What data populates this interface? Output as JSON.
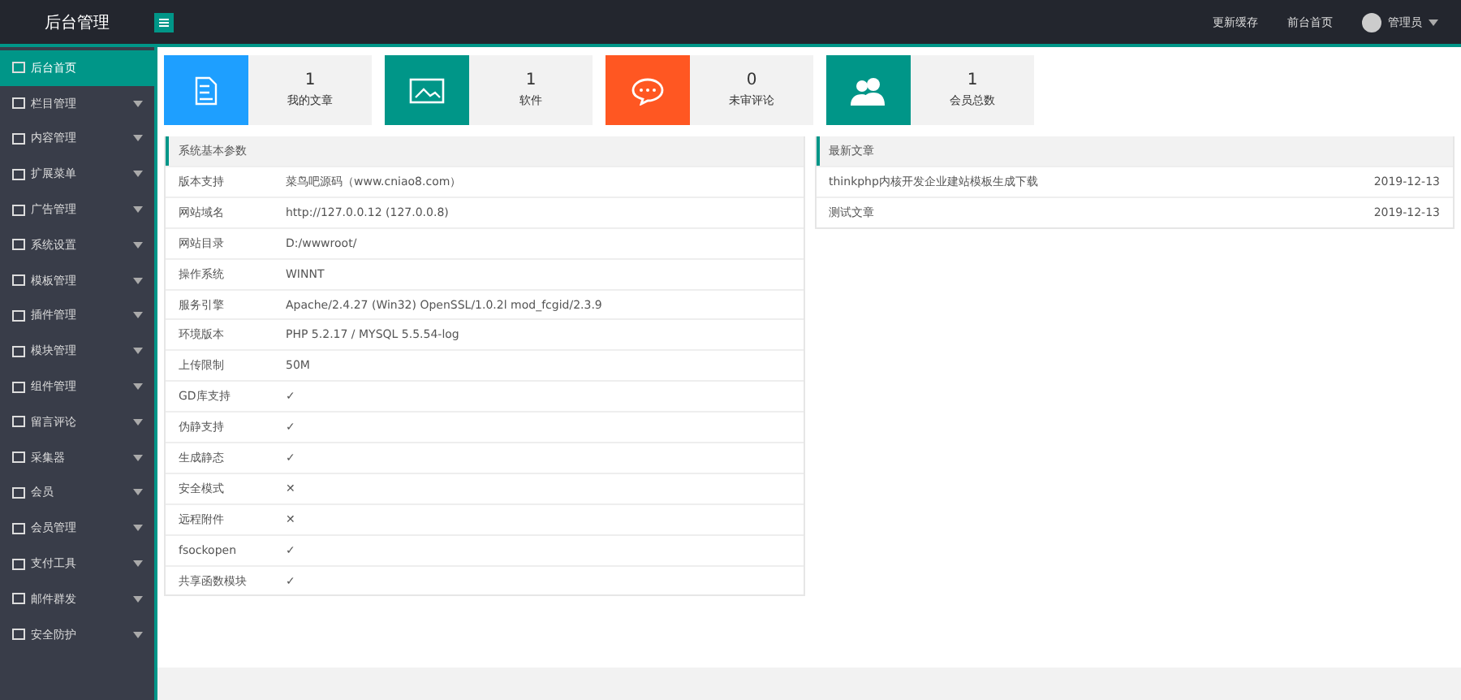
{
  "header": {
    "title": "后台管理",
    "links": [
      "更新缓存",
      "前台首页"
    ],
    "user": "管理员"
  },
  "sidebar": {
    "items": [
      {
        "label": "后台首页",
        "selected": true,
        "expandable": false
      },
      {
        "label": "栏目管理",
        "selected": false,
        "expandable": true
      },
      {
        "label": "内容管理",
        "selected": false,
        "expandable": true
      },
      {
        "label": "扩展菜单",
        "selected": false,
        "expandable": true
      },
      {
        "label": "广告管理",
        "selected": false,
        "expandable": true
      },
      {
        "label": "系统设置",
        "selected": false,
        "expandable": true
      },
      {
        "label": "模板管理",
        "selected": false,
        "expandable": true
      },
      {
        "label": "插件管理",
        "selected": false,
        "expandable": true
      },
      {
        "label": "模块管理",
        "selected": false,
        "expandable": true
      },
      {
        "label": "组件管理",
        "selected": false,
        "expandable": true
      },
      {
        "label": "留言评论",
        "selected": false,
        "expandable": true
      },
      {
        "label": "采集器",
        "selected": false,
        "expandable": true
      },
      {
        "label": "会员",
        "selected": false,
        "expandable": true
      },
      {
        "label": "会员管理",
        "selected": false,
        "expandable": true
      },
      {
        "label": "支付工具",
        "selected": false,
        "expandable": true
      },
      {
        "label": "邮件群发",
        "selected": false,
        "expandable": true
      },
      {
        "label": "安全防护",
        "selected": false,
        "expandable": true
      }
    ]
  },
  "stats": [
    {
      "value": "1",
      "label": "我的文章",
      "color": "#1e9fff"
    },
    {
      "value": "1",
      "label": "软件",
      "color": "#009688"
    },
    {
      "value": "0",
      "label": "未审评论",
      "color": "#ff5722"
    },
    {
      "value": "1",
      "label": "会员总数",
      "color": "#009688"
    }
  ],
  "system_panel": {
    "title": "系统基本参数",
    "rows": [
      {
        "name": "版本支持",
        "value": "菜鸟吧源码（www.cniao8.com）"
      },
      {
        "name": "网站域名",
        "value": "http://127.0.0.12 (127.0.0.8)"
      },
      {
        "name": "网站目录",
        "value": "D:/wwwroot/"
      },
      {
        "name": "操作系统",
        "value": "WINNT"
      },
      {
        "name": "服务引擎",
        "value": "Apache/2.4.27 (Win32) OpenSSL/1.0.2l mod_fcgid/2.3.9"
      },
      {
        "name": "环境版本",
        "value": "PHP 5.2.17 / MYSQL 5.5.54-log"
      },
      {
        "name": "上传限制",
        "value": "50M"
      },
      {
        "name": "GD库支持",
        "value": "✓"
      },
      {
        "name": "伪静支持",
        "value": "✓"
      },
      {
        "name": "生成静态",
        "value": "✓"
      },
      {
        "name": "安全模式",
        "value": "✕"
      },
      {
        "name": "远程附件",
        "value": "✕"
      },
      {
        "name": "fsockopen",
        "value": "✓"
      },
      {
        "name": "共享函数模块",
        "value": "✓"
      }
    ]
  },
  "articles_panel": {
    "title": "最新文章",
    "rows": [
      {
        "title": "thinkphp内核开发企业建站模板生成下载",
        "date": "2019-12-13"
      },
      {
        "title": "测试文章",
        "date": "2019-12-13"
      }
    ]
  }
}
